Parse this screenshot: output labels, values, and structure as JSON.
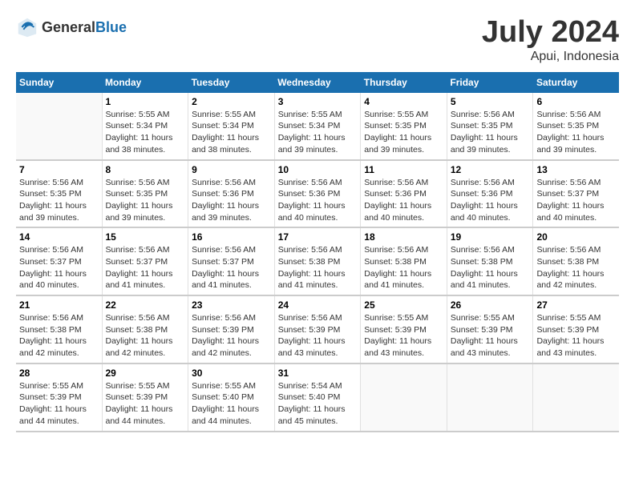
{
  "header": {
    "logo_general": "General",
    "logo_blue": "Blue",
    "main_title": "July 2024",
    "subtitle": "Apui, Indonesia"
  },
  "calendar": {
    "days_of_week": [
      "Sunday",
      "Monday",
      "Tuesday",
      "Wednesday",
      "Thursday",
      "Friday",
      "Saturday"
    ],
    "weeks": [
      [
        {
          "day": "",
          "sunrise": "",
          "sunset": "",
          "daylight": ""
        },
        {
          "day": "1",
          "sunrise": "Sunrise: 5:55 AM",
          "sunset": "Sunset: 5:34 PM",
          "daylight": "Daylight: 11 hours and 38 minutes."
        },
        {
          "day": "2",
          "sunrise": "Sunrise: 5:55 AM",
          "sunset": "Sunset: 5:34 PM",
          "daylight": "Daylight: 11 hours and 38 minutes."
        },
        {
          "day": "3",
          "sunrise": "Sunrise: 5:55 AM",
          "sunset": "Sunset: 5:34 PM",
          "daylight": "Daylight: 11 hours and 39 minutes."
        },
        {
          "day": "4",
          "sunrise": "Sunrise: 5:55 AM",
          "sunset": "Sunset: 5:35 PM",
          "daylight": "Daylight: 11 hours and 39 minutes."
        },
        {
          "day": "5",
          "sunrise": "Sunrise: 5:56 AM",
          "sunset": "Sunset: 5:35 PM",
          "daylight": "Daylight: 11 hours and 39 minutes."
        },
        {
          "day": "6",
          "sunrise": "Sunrise: 5:56 AM",
          "sunset": "Sunset: 5:35 PM",
          "daylight": "Daylight: 11 hours and 39 minutes."
        }
      ],
      [
        {
          "day": "7",
          "sunrise": "Sunrise: 5:56 AM",
          "sunset": "Sunset: 5:35 PM",
          "daylight": "Daylight: 11 hours and 39 minutes."
        },
        {
          "day": "8",
          "sunrise": "Sunrise: 5:56 AM",
          "sunset": "Sunset: 5:35 PM",
          "daylight": "Daylight: 11 hours and 39 minutes."
        },
        {
          "day": "9",
          "sunrise": "Sunrise: 5:56 AM",
          "sunset": "Sunset: 5:36 PM",
          "daylight": "Daylight: 11 hours and 39 minutes."
        },
        {
          "day": "10",
          "sunrise": "Sunrise: 5:56 AM",
          "sunset": "Sunset: 5:36 PM",
          "daylight": "Daylight: 11 hours and 40 minutes."
        },
        {
          "day": "11",
          "sunrise": "Sunrise: 5:56 AM",
          "sunset": "Sunset: 5:36 PM",
          "daylight": "Daylight: 11 hours and 40 minutes."
        },
        {
          "day": "12",
          "sunrise": "Sunrise: 5:56 AM",
          "sunset": "Sunset: 5:36 PM",
          "daylight": "Daylight: 11 hours and 40 minutes."
        },
        {
          "day": "13",
          "sunrise": "Sunrise: 5:56 AM",
          "sunset": "Sunset: 5:37 PM",
          "daylight": "Daylight: 11 hours and 40 minutes."
        }
      ],
      [
        {
          "day": "14",
          "sunrise": "Sunrise: 5:56 AM",
          "sunset": "Sunset: 5:37 PM",
          "daylight": "Daylight: 11 hours and 40 minutes."
        },
        {
          "day": "15",
          "sunrise": "Sunrise: 5:56 AM",
          "sunset": "Sunset: 5:37 PM",
          "daylight": "Daylight: 11 hours and 41 minutes."
        },
        {
          "day": "16",
          "sunrise": "Sunrise: 5:56 AM",
          "sunset": "Sunset: 5:37 PM",
          "daylight": "Daylight: 11 hours and 41 minutes."
        },
        {
          "day": "17",
          "sunrise": "Sunrise: 5:56 AM",
          "sunset": "Sunset: 5:38 PM",
          "daylight": "Daylight: 11 hours and 41 minutes."
        },
        {
          "day": "18",
          "sunrise": "Sunrise: 5:56 AM",
          "sunset": "Sunset: 5:38 PM",
          "daylight": "Daylight: 11 hours and 41 minutes."
        },
        {
          "day": "19",
          "sunrise": "Sunrise: 5:56 AM",
          "sunset": "Sunset: 5:38 PM",
          "daylight": "Daylight: 11 hours and 41 minutes."
        },
        {
          "day": "20",
          "sunrise": "Sunrise: 5:56 AM",
          "sunset": "Sunset: 5:38 PM",
          "daylight": "Daylight: 11 hours and 42 minutes."
        }
      ],
      [
        {
          "day": "21",
          "sunrise": "Sunrise: 5:56 AM",
          "sunset": "Sunset: 5:38 PM",
          "daylight": "Daylight: 11 hours and 42 minutes."
        },
        {
          "day": "22",
          "sunrise": "Sunrise: 5:56 AM",
          "sunset": "Sunset: 5:38 PM",
          "daylight": "Daylight: 11 hours and 42 minutes."
        },
        {
          "day": "23",
          "sunrise": "Sunrise: 5:56 AM",
          "sunset": "Sunset: 5:39 PM",
          "daylight": "Daylight: 11 hours and 42 minutes."
        },
        {
          "day": "24",
          "sunrise": "Sunrise: 5:56 AM",
          "sunset": "Sunset: 5:39 PM",
          "daylight": "Daylight: 11 hours and 43 minutes."
        },
        {
          "day": "25",
          "sunrise": "Sunrise: 5:55 AM",
          "sunset": "Sunset: 5:39 PM",
          "daylight": "Daylight: 11 hours and 43 minutes."
        },
        {
          "day": "26",
          "sunrise": "Sunrise: 5:55 AM",
          "sunset": "Sunset: 5:39 PM",
          "daylight": "Daylight: 11 hours and 43 minutes."
        },
        {
          "day": "27",
          "sunrise": "Sunrise: 5:55 AM",
          "sunset": "Sunset: 5:39 PM",
          "daylight": "Daylight: 11 hours and 43 minutes."
        }
      ],
      [
        {
          "day": "28",
          "sunrise": "Sunrise: 5:55 AM",
          "sunset": "Sunset: 5:39 PM",
          "daylight": "Daylight: 11 hours and 44 minutes."
        },
        {
          "day": "29",
          "sunrise": "Sunrise: 5:55 AM",
          "sunset": "Sunset: 5:39 PM",
          "daylight": "Daylight: 11 hours and 44 minutes."
        },
        {
          "day": "30",
          "sunrise": "Sunrise: 5:55 AM",
          "sunset": "Sunset: 5:40 PM",
          "daylight": "Daylight: 11 hours and 44 minutes."
        },
        {
          "day": "31",
          "sunrise": "Sunrise: 5:54 AM",
          "sunset": "Sunset: 5:40 PM",
          "daylight": "Daylight: 11 hours and 45 minutes."
        },
        {
          "day": "",
          "sunrise": "",
          "sunset": "",
          "daylight": ""
        },
        {
          "day": "",
          "sunrise": "",
          "sunset": "",
          "daylight": ""
        },
        {
          "day": "",
          "sunrise": "",
          "sunset": "",
          "daylight": ""
        }
      ]
    ]
  }
}
